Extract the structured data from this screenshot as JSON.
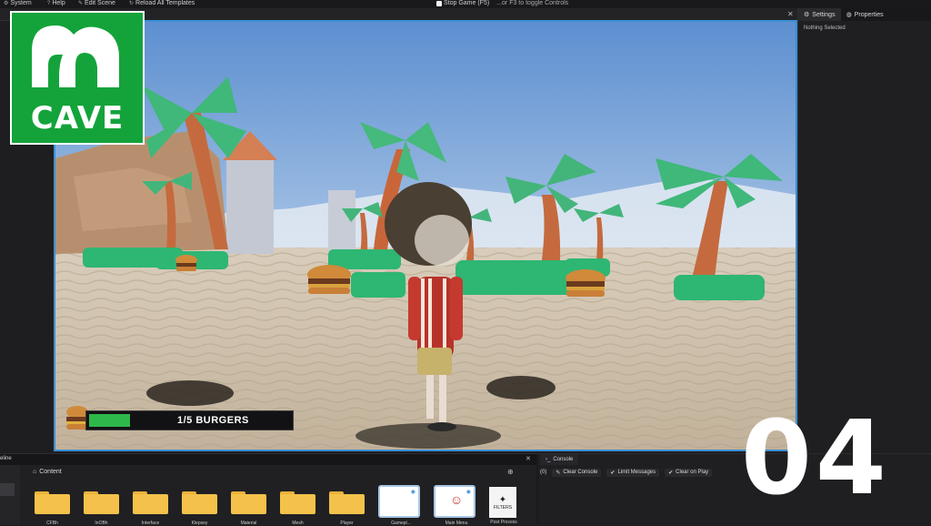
{
  "menu": {
    "system": "System",
    "help": "Help",
    "edit_scene": "Edit Scene",
    "reload_templates": "Reload All Templates",
    "stop_game": "Stop Game (F5)",
    "toggle_hint": "...or F3 to toggle Controls"
  },
  "right_panel": {
    "tabs": [
      {
        "label": "Settings",
        "icon": "gear-icon"
      },
      {
        "label": "Properties",
        "icon": "globe-icon"
      }
    ],
    "status": "Nothing Selected"
  },
  "hud": {
    "burgers_text": "1/5 BURGERS",
    "progress": 0.2
  },
  "logo": {
    "text": "CAVE",
    "color": "#14a33a"
  },
  "episode": "04",
  "bottom": {
    "left_tab": "eline",
    "content_title": "Content",
    "folders": [
      "CFBh",
      "InOBh",
      "Interface",
      "Klepsey",
      "Material",
      "Mesh",
      "Player"
    ],
    "templates": [
      "Gamepl...",
      "Main Menu"
    ],
    "filters_label": "FILTERS",
    "filters_item": "Post Process"
  },
  "console": {
    "tab": "Console",
    "count": "(0)",
    "clear_console": "Clear Console",
    "limit_messages": "Limit Messages",
    "clear_on_play": "Clear on Play"
  },
  "colors": {
    "accent": "#3a8fd6",
    "hud_green": "#2fb84a",
    "folder": "#f4c24a"
  }
}
